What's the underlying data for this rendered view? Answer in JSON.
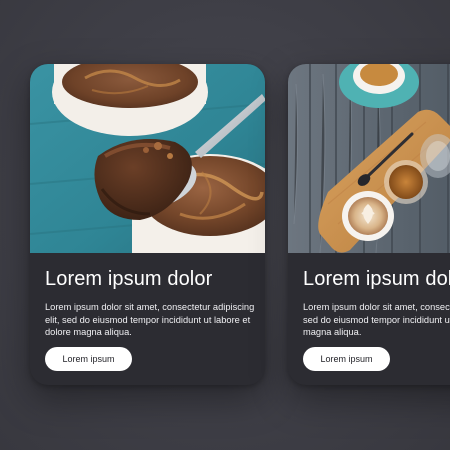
{
  "cards": [
    {
      "title": "Lorem ipsum dolor",
      "body": "Lorem ipsum dolor sit amet, consectetur adipiscing elit, sed do eiusmod tempor incididunt ut labore et dolore magna aliqua.",
      "button_label": "Lorem ipsum",
      "image_subject": "chocolate-dessert-photo"
    },
    {
      "title": "Lorem ipsum dolor",
      "body": "Lorem ipsum dolor sit amet, consectetur adipiscing elit, sed do eiusmod tempor incididunt ut labore et dolore magna aliqua.",
      "button_label": "Lorem ipsum",
      "image_subject": "coffee-tray-photo"
    }
  ],
  "colors": {
    "background": "#3f3f47",
    "card": "#2c2c32",
    "button": "#ffffff",
    "button_text": "#1e1e24",
    "title_text": "#ffffff"
  }
}
